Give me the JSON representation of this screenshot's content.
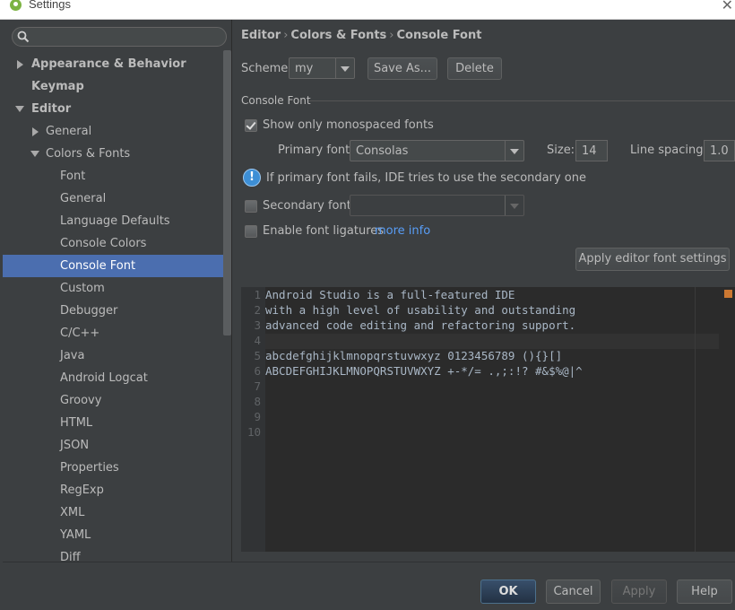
{
  "window": {
    "title": "Settings"
  },
  "sidebar": {
    "search_placeholder": "",
    "items": [
      {
        "label": "Appearance & Behavior",
        "expanded": false
      },
      {
        "label": "Keymap"
      },
      {
        "label": "Editor",
        "expanded": true
      },
      {
        "label": "General",
        "expanded": false
      },
      {
        "label": "Colors & Fonts",
        "expanded": true
      },
      {
        "label": "Font"
      },
      {
        "label": "General"
      },
      {
        "label": "Language Defaults"
      },
      {
        "label": "Console Colors"
      },
      {
        "label": "Console Font",
        "selected": true
      },
      {
        "label": "Custom"
      },
      {
        "label": "Debugger"
      },
      {
        "label": "C/C++"
      },
      {
        "label": "Java"
      },
      {
        "label": "Android Logcat"
      },
      {
        "label": "Groovy"
      },
      {
        "label": "HTML"
      },
      {
        "label": "JSON"
      },
      {
        "label": "Properties"
      },
      {
        "label": "RegExp"
      },
      {
        "label": "XML"
      },
      {
        "label": "YAML"
      },
      {
        "label": "Diff"
      }
    ]
  },
  "breadcrumb": [
    "Editor",
    "Colors & Fonts",
    "Console Font"
  ],
  "scheme": {
    "label": "Scheme:",
    "value": "my",
    "save_as": "Save As...",
    "delete": "Delete"
  },
  "console_font": {
    "section_title": "Console Font",
    "show_mono_label": "Show only monospaced fonts",
    "show_mono_checked": true,
    "primary_font_label": "Primary font:",
    "primary_font_value": "Consolas",
    "size_label": "Size:",
    "size_value": "14",
    "line_spacing_label": "Line spacing:",
    "line_spacing_value": "1.0",
    "info_text": "If primary font fails, IDE tries to use the secondary one",
    "secondary_font_label": "Secondary font:",
    "secondary_font_checked": false,
    "secondary_font_value": "",
    "ligatures_label": "Enable font ligatures",
    "ligatures_checked": false,
    "more_info": "more info",
    "apply_editor_font": "Apply editor font settings"
  },
  "preview": {
    "lines": [
      {
        "n": "1",
        "text": "Android Studio is a full-featured IDE"
      },
      {
        "n": "2",
        "text": "with a high level of usability and outstanding"
      },
      {
        "n": "3",
        "text": "advanced code editing and refactoring support."
      },
      {
        "n": "4",
        "text": ""
      },
      {
        "n": "5",
        "text": "abcdefghijklmnopqrstuvwxyz 0123456789 (){}[]"
      },
      {
        "n": "6",
        "text": "ABCDEFGHIJKLMNOPQRSTUVWXYZ +-*/= .,;:!? #&$%@|^"
      },
      {
        "n": "7",
        "text": ""
      },
      {
        "n": "8",
        "text": ""
      },
      {
        "n": "9",
        "text": ""
      },
      {
        "n": "10",
        "text": ""
      }
    ]
  },
  "footer": {
    "ok": "OK",
    "cancel": "Cancel",
    "apply": "Apply",
    "help": "Help"
  },
  "colors": {
    "selection": "#4b6eaf",
    "background": "#3c3f41",
    "editor_background": "#2b2b2b",
    "link": "#589df6",
    "marker": "#cc7832"
  }
}
